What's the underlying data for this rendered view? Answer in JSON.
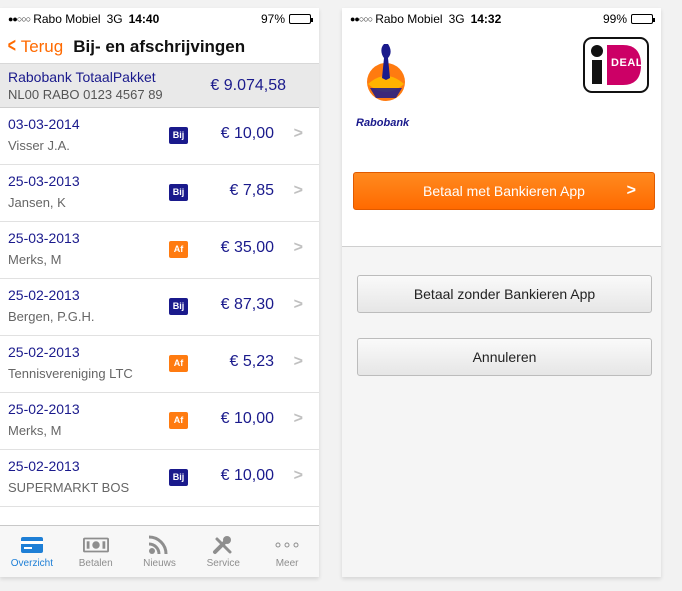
{
  "left": {
    "status": {
      "carrier": "Rabo Mobiel",
      "network": "3G",
      "time": "14:40",
      "battery": "97%",
      "battery_level": 0.97
    },
    "nav": {
      "back": "Terug",
      "title": "Bij- en afschrijvingen"
    },
    "account": {
      "name": "Rabobank TotaalPakket",
      "iban": "NL00 RABO 0123 4567 89",
      "balance": "€ 9.074,58"
    },
    "transactions": [
      {
        "date": "03-03-2014",
        "name": "Visser J.A.",
        "type": "Bij",
        "amount": "€ 10,00"
      },
      {
        "date": "25-03-2013",
        "name": "Jansen, K",
        "type": "Bij",
        "amount": "€ 7,85"
      },
      {
        "date": "25-03-2013",
        "name": "Merks, M",
        "type": "Af",
        "amount": "€ 35,00"
      },
      {
        "date": "25-02-2013",
        "name": "Bergen, P.G.H.",
        "type": "Bij",
        "amount": "€ 87,30"
      },
      {
        "date": "25-02-2013",
        "name": "Tennisvereniging LTC",
        "type": "Af",
        "amount": "€ 5,23"
      },
      {
        "date": "25-02-2013",
        "name": "Merks, M",
        "type": "Af",
        "amount": "€ 10,00"
      },
      {
        "date": "25-02-2013",
        "name": "SUPERMARKT BOS",
        "type": "Bij",
        "amount": "€ 10,00"
      }
    ],
    "tabs": [
      {
        "label": "Overzicht",
        "icon": "card-icon",
        "active": true
      },
      {
        "label": "Betalen",
        "icon": "cash-icon",
        "active": false
      },
      {
        "label": "Nieuws",
        "icon": "rss-icon",
        "active": false
      },
      {
        "label": "Service",
        "icon": "tools-icon",
        "active": false
      },
      {
        "label": "Meer",
        "icon": "more-icon",
        "active": false
      }
    ]
  },
  "right": {
    "status": {
      "carrier": "Rabo Mobiel",
      "network": "3G",
      "time": "14:32",
      "battery": "99%",
      "battery_level": 0.99
    },
    "logos": {
      "bank": "Rabobank",
      "ideal": "DEAL"
    },
    "buttons": {
      "primary": "Betaal met Bankieren App",
      "secondary": "Betaal zonder Bankieren App",
      "cancel": "Annuleren"
    }
  },
  "colors": {
    "accent": "#ff6a00",
    "navy": "#1a1a8c",
    "bij_badge": "#1a1a8c",
    "af_badge": "#ff7b10",
    "tab_active": "#1e7fd6"
  }
}
